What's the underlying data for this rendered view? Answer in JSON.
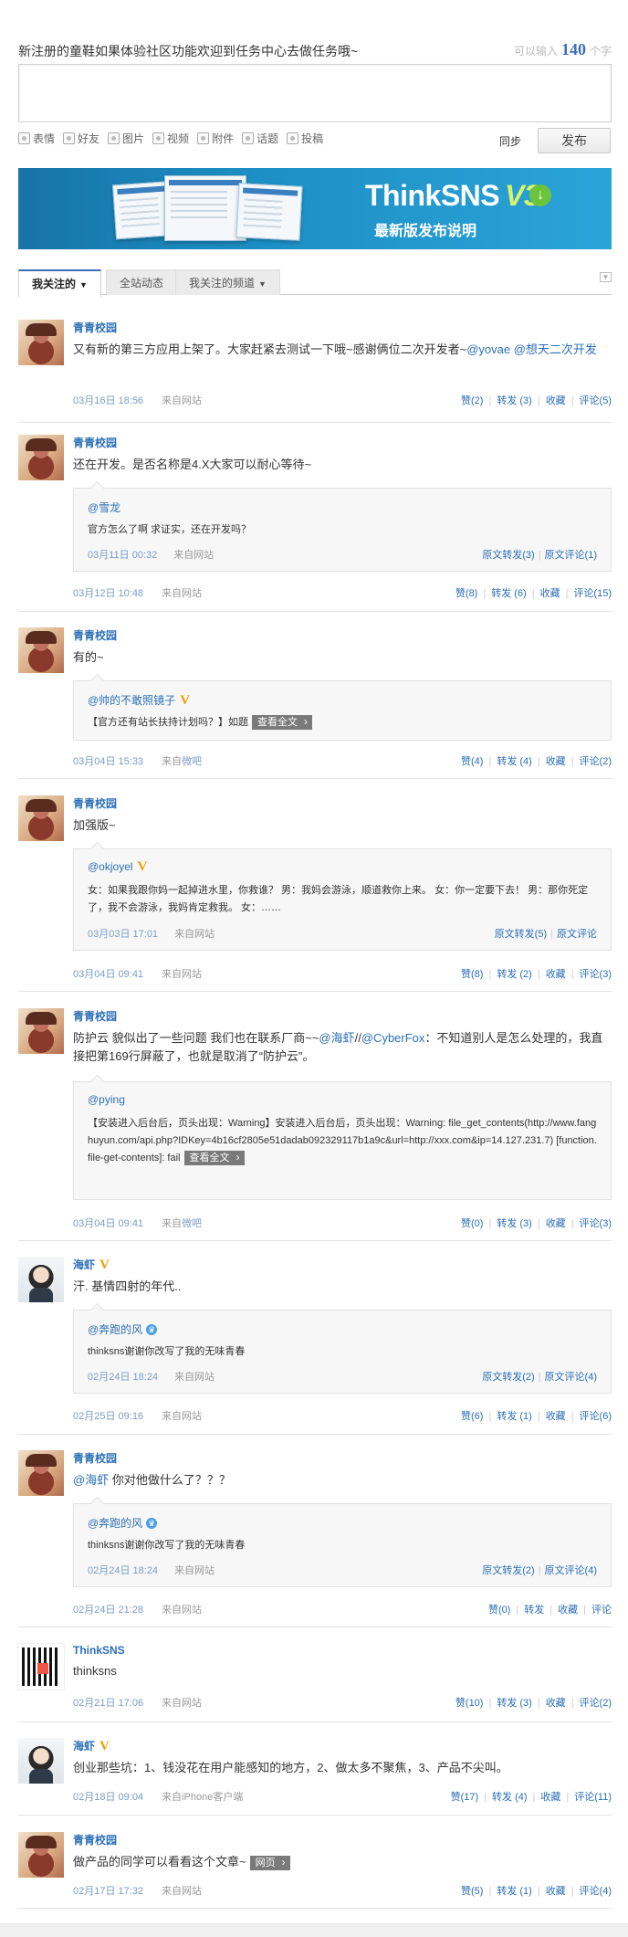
{
  "composer": {
    "prompt": "新注册的童鞋如果体验社区功能欢迎到任务中心去做任务哦~",
    "counter_prefix": "可以输入",
    "counter_value": "140",
    "counter_suffix": "个字",
    "tools": [
      "表情",
      "好友",
      "图片",
      "视频",
      "附件",
      "话题",
      "投稿"
    ],
    "sync_label": "同步",
    "publish_label": "发布"
  },
  "banner": {
    "logo_text": "ThinkSNS",
    "logo_version": "V3",
    "subtitle": "最新版发布说明"
  },
  "tabs": [
    {
      "label": "我关注的",
      "caret": "▼"
    },
    {
      "label": "全站动态"
    },
    {
      "label": "我关注的频道",
      "caret": "▼"
    }
  ],
  "posts": [
    {
      "author": "青青校园",
      "text_pre": "又有新的第三方应用上架了。大家赶紧去测试一下哦~感谢俩位二次开发者~",
      "mention1": "@yovae",
      "mention2": "@想天二次开发",
      "time": "03月16日 18:56",
      "source": "来自网站",
      "actions": [
        "赞(2)",
        "转发 (3)",
        "收藏",
        "评论(5)"
      ]
    },
    {
      "author": "青青校园",
      "text": "还在开发。是否名称是4.X大家可以耐心等待~",
      "quote": {
        "author": "@雪龙",
        "text": "官方怎么了啊 求证实，还在开发吗？",
        "time": "03月11日 00:32",
        "source": "来自网站",
        "actions": [
          "原文转发(3)",
          "原文评论(1)"
        ]
      },
      "time": "03月12日 10:48",
      "source": "来自网站",
      "actions": [
        "赞(8)",
        "转发 (6)",
        "收藏",
        "评论(15)"
      ]
    },
    {
      "author": "青青校园",
      "text": "有的~",
      "quote": {
        "author": "@帅的不敢照镜子",
        "badge": "V",
        "text": "【官方还有站长扶持计划吗？】如题",
        "more": "查看全文"
      },
      "time": "03月04日 15:33",
      "source_prefix": "来自",
      "source_link": "微吧",
      "actions": [
        "赞(4)",
        "转发 (4)",
        "收藏",
        "评论(2)"
      ]
    },
    {
      "author": "青青校园",
      "text": "加强版~",
      "quote": {
        "author": "@okjoyel",
        "badge": "V",
        "text": "女：如果我跟你妈一起掉进水里，你救谁？ 男：我妈会游泳，顺道救你上来。 女：你一定要下去！ 男：那你死定了，我不会游泳，我妈肯定救我。 女：……",
        "time": "03月03日 17:01",
        "source": "来自网站",
        "actions": [
          "原文转发(5)",
          "原文评论"
        ]
      },
      "time": "03月04日 09:41",
      "source": "来自网站",
      "actions": [
        "赞(8)",
        "转发 (2)",
        "收藏",
        "评论(3)"
      ]
    },
    {
      "author": "青青校园",
      "text_pre": "防护云 貌似出了一些问题 我们也在联系厂商~~",
      "mention1": "@海虾",
      "text_mid": "//",
      "mention2": "@CyberFox",
      "text_post": "：不知道别人是怎么处理的，我直接把第169行屏蔽了，也就是取消了“防护云”。",
      "quote": {
        "author": "@pying",
        "text": "【安装进入后台后，页头出现：Warning】安装进入后台后，页头出现：Warning: file_get_contents(http://www.fanghuyun.com/api.php?IDKey=4b16cf2805e51dadab092329117b1a9c&url=http://xxx.com&ip=14.127.231.7) [function.file-get-contents]: fail",
        "more": "查看全文"
      },
      "time": "03月04日 09:41",
      "source_prefix": "来自",
      "source_link": "微吧",
      "actions": [
        "赞(0)",
        "转发 (3)",
        "收藏",
        "评论(3)"
      ]
    },
    {
      "author": "海虾",
      "badge": "V",
      "text": "汗. 基情四射的年代..",
      "quote": {
        "author": "@奔跑的风",
        "text": "thinksns谢谢你改写了我的无味青春",
        "time": "02月24日 18:24",
        "source": "来自网站",
        "actions": [
          "原文转发(2)",
          "原文评论(4)"
        ]
      },
      "time": "02月25日 09:16",
      "source": "来自网站",
      "actions": [
        "赞(6)",
        "转发 (1)",
        "收藏",
        "评论(6)"
      ]
    },
    {
      "author": "青青校园",
      "mention1": "@海虾",
      "text_post": " 你对他做什么了？？？",
      "quote": {
        "author": "@奔跑的风",
        "text": "thinksns谢谢你改写了我的无味青春",
        "time": "02月24日 18:24",
        "source": "来自网站",
        "actions": [
          "原文转发(2)",
          "原文评论(4)"
        ]
      },
      "time": "02月24日 21:28",
      "source": "来自网站",
      "actions": [
        "赞(0)",
        "转发",
        "收藏",
        "评论"
      ]
    },
    {
      "author": "ThinkSNS",
      "text": "thinksns",
      "time": "02月21日 17:06",
      "source": "来自网站",
      "actions": [
        "赞(10)",
        "转发 (3)",
        "收藏",
        "评论(2)"
      ]
    },
    {
      "author": "海虾",
      "badge": "V",
      "text": "创业那些坑：1、钱没花在用户能感知的地方，2、做太多不聚焦，3、产品不尖叫。",
      "time": "02月18日 09:04",
      "source": "来自iPhone客户端",
      "actions": [
        "赞(17)",
        "转发 (4)",
        "收藏",
        "评论(11)"
      ]
    },
    {
      "author": "青青校园",
      "text": "做产品的同学可以看看这个文章~",
      "more": "网页",
      "time": "02月17日 17:32",
      "source": "来自网站",
      "actions": [
        "赞(5)",
        "转发 (1)",
        "收藏",
        "评论(4)"
      ]
    }
  ]
}
